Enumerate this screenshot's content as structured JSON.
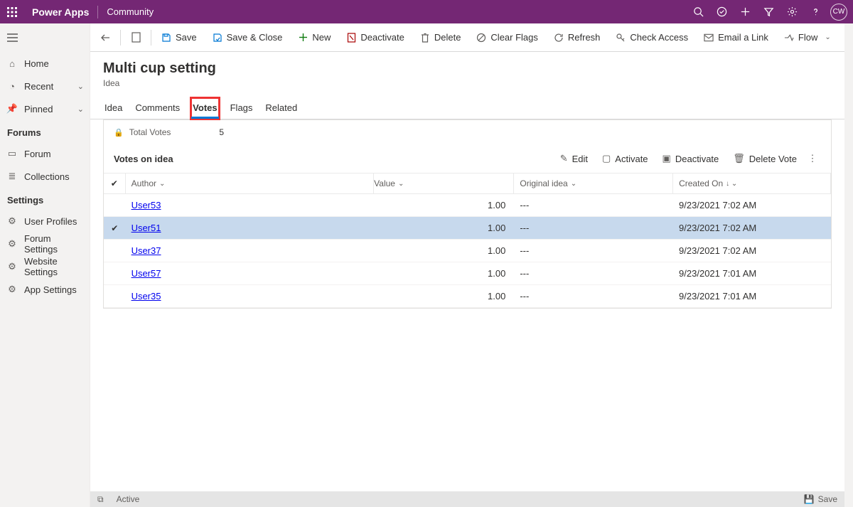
{
  "brand": {
    "app": "Power Apps",
    "env": "Community",
    "avatar": "CW"
  },
  "leftnav": {
    "home": "Home",
    "recent": "Recent",
    "pinned": "Pinned",
    "group_forums": "Forums",
    "forum": "Forum",
    "collections": "Collections",
    "group_settings": "Settings",
    "user_profiles": "User Profiles",
    "forum_settings": "Forum Settings",
    "website_settings": "Website Settings",
    "app_settings": "App Settings"
  },
  "commands": {
    "save": "Save",
    "save_close": "Save & Close",
    "new": "New",
    "deactivate": "Deactivate",
    "delete": "Delete",
    "clear_flags": "Clear Flags",
    "refresh": "Refresh",
    "check_access": "Check Access",
    "email_link": "Email a Link",
    "flow": "Flow"
  },
  "page": {
    "title": "Multi cup setting",
    "subtitle": "Idea"
  },
  "tabs": {
    "idea": "Idea",
    "comments": "Comments",
    "votes": "Votes",
    "flags": "Flags",
    "related": "Related"
  },
  "votes": {
    "total_label": "Total Votes",
    "total_value": "5",
    "section_title": "Votes on idea",
    "grid_actions": {
      "edit": "Edit",
      "activate": "Activate",
      "deactivate": "Deactivate",
      "delete_vote": "Delete Vote"
    },
    "columns": {
      "author": "Author",
      "value": "Value",
      "original_idea": "Original idea",
      "created_on": "Created On"
    },
    "rows": [
      {
        "selected": false,
        "author": "User53",
        "value": "1.00",
        "original": "---",
        "created": "9/23/2021 7:02 AM"
      },
      {
        "selected": true,
        "author": "User51",
        "value": "1.00",
        "original": "---",
        "created": "9/23/2021 7:02 AM"
      },
      {
        "selected": false,
        "author": "User37",
        "value": "1.00",
        "original": "---",
        "created": "9/23/2021 7:02 AM"
      },
      {
        "selected": false,
        "author": "User57",
        "value": "1.00",
        "original": "---",
        "created": "9/23/2021 7:01 AM"
      },
      {
        "selected": false,
        "author": "User35",
        "value": "1.00",
        "original": "---",
        "created": "9/23/2021 7:01 AM"
      }
    ]
  },
  "statusbar": {
    "state": "Active",
    "save": "Save"
  }
}
